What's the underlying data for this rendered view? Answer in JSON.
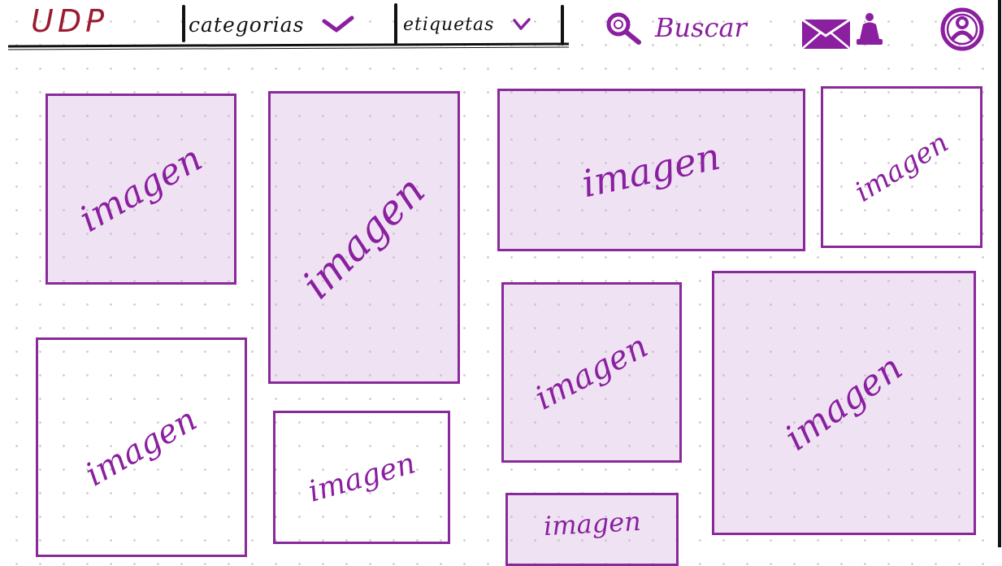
{
  "header": {
    "logo": "UDP",
    "categories_label": "categorias",
    "tags_label": "etiquetas",
    "search_label": "Buscar"
  },
  "colors": {
    "accent": "#8a1fa0",
    "logo": "#9b1b30",
    "ink": "#111111"
  },
  "icons": [
    "chevron-down-icon",
    "search-icon",
    "mail-icon",
    "bell-icon",
    "user-avatar-icon"
  ],
  "gallery": {
    "cards": [
      {
        "label": "imagen",
        "filled": true
      },
      {
        "label": "imagen",
        "filled": true
      },
      {
        "label": "imagen",
        "filled": true
      },
      {
        "label": "imagen",
        "filled": false
      },
      {
        "label": "imagen",
        "filled": false
      },
      {
        "label": "imagen",
        "filled": false
      },
      {
        "label": "imagen",
        "filled": true
      },
      {
        "label": "imagen",
        "filled": true
      },
      {
        "label": "imagen",
        "filled": true
      }
    ]
  }
}
